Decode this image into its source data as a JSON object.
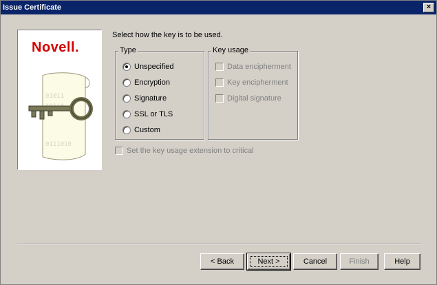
{
  "window": {
    "title": "Issue Certificate",
    "close_glyph": "×"
  },
  "logo": {
    "brand": "Novell.",
    "art": "key-on-paper-illustration"
  },
  "prompt": "Select how the key is to be used.",
  "type_group": {
    "legend": "Type",
    "options": [
      {
        "label": "Unspecified",
        "checked": true
      },
      {
        "label": "Encryption",
        "checked": false
      },
      {
        "label": "Signature",
        "checked": false
      },
      {
        "label": "SSL or TLS",
        "checked": false
      },
      {
        "label": "Custom",
        "checked": false
      }
    ]
  },
  "key_usage_group": {
    "legend": "Key usage",
    "options": [
      {
        "label": "Data encipherment",
        "enabled": false
      },
      {
        "label": "Key encipherment",
        "enabled": false
      },
      {
        "label": "Digital signature",
        "enabled": false
      }
    ]
  },
  "critical_checkbox": {
    "label": "Set the key usage extension to critical",
    "enabled": false
  },
  "buttons": {
    "back": "< Back",
    "next": "Next >",
    "cancel": "Cancel",
    "finish": "Finish",
    "help": "Help"
  },
  "colors": {
    "titlebar": "#0a246a",
    "brand": "#d50000",
    "dialog": "#d4d0c8"
  }
}
